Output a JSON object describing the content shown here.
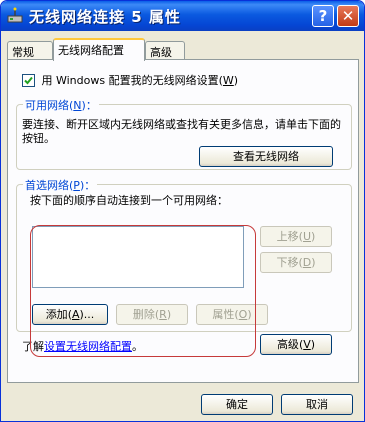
{
  "window": {
    "title": "无线网络连接 5 属性"
  },
  "titlebar_buttons": {
    "help": "?",
    "close": "✕"
  },
  "tabs": [
    {
      "label": "常规"
    },
    {
      "label": "无线网络配置"
    },
    {
      "label": "高级"
    }
  ],
  "use_windows": {
    "checked": true,
    "label": "用 Windows 配置我的无线网络设置",
    "shortcut": "W"
  },
  "available": {
    "legend": "可用网络",
    "shortcut": "N",
    "description": "要连接、断开区域内无线网络或查找有关更多信息，请单击下面的按钮。",
    "view_button": "查看无线网络"
  },
  "preferred": {
    "legend": "首选网络",
    "shortcut": "P",
    "description": "按下面的顺序自动连接到一个可用网络：",
    "items": [],
    "up_button": "上移",
    "up_shortcut": "U",
    "down_button": "下移",
    "down_shortcut": "D",
    "add_button": "添加",
    "add_shortcut": "A",
    "remove_button": "删除",
    "remove_shortcut": "R",
    "props_button": "属性",
    "props_shortcut": "O"
  },
  "learn": {
    "prefix": "了解",
    "link": "设置无线网络配置",
    "suffix": "。"
  },
  "advanced_button": {
    "label": "高级",
    "shortcut": "V"
  },
  "footer": {
    "ok": "确定",
    "cancel": "取消"
  },
  "colors": {
    "titlebar": "#0a5ee8",
    "legend": "#0046d5",
    "highlight": "#c63a3a",
    "link": "#0000ff"
  }
}
